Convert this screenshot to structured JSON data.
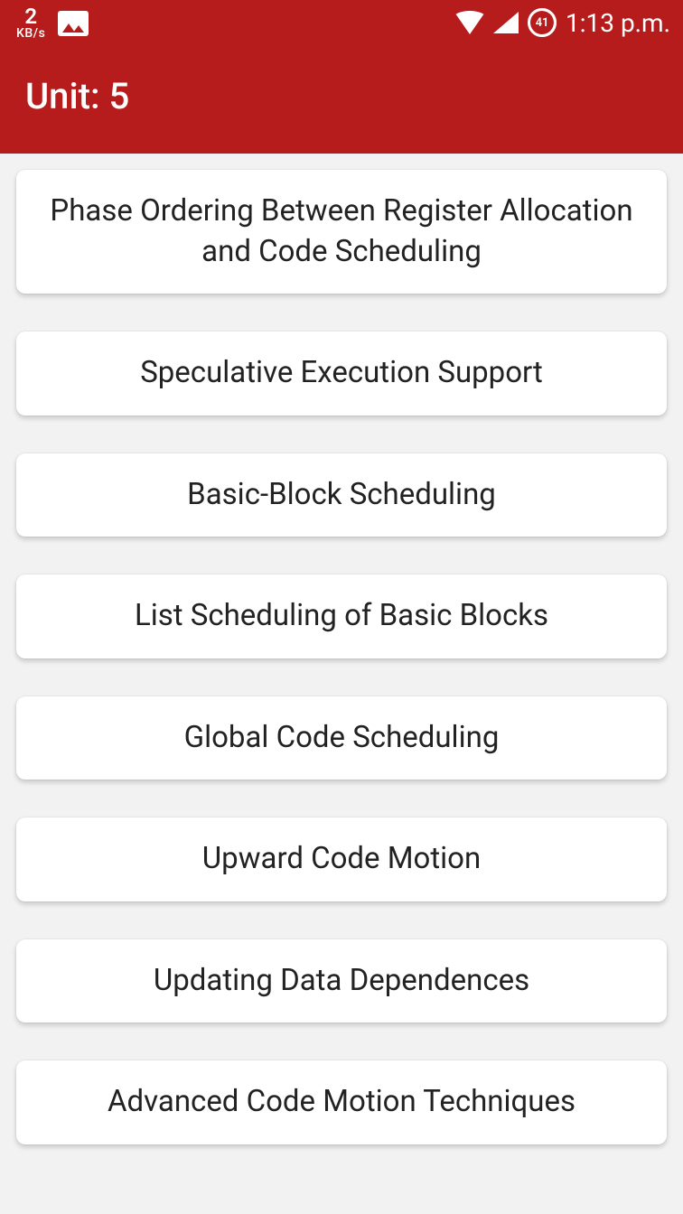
{
  "status": {
    "net_speed_num": "2",
    "net_speed_unit": "KB/s",
    "battery": "41",
    "time": "1:13 p.m."
  },
  "header": {
    "title": "Unit: 5"
  },
  "topics": [
    {
      "label": "Phase Ordering Between Register Allocation and Code Scheduling"
    },
    {
      "label": "Speculative Execution Support"
    },
    {
      "label": "Basic-Block Scheduling"
    },
    {
      "label": "List Scheduling of Basic Blocks"
    },
    {
      "label": "Global Code Scheduling"
    },
    {
      "label": "Upward Code Motion"
    },
    {
      "label": "Updating Data Dependences"
    },
    {
      "label": "Advanced Code Motion Techniques"
    }
  ]
}
